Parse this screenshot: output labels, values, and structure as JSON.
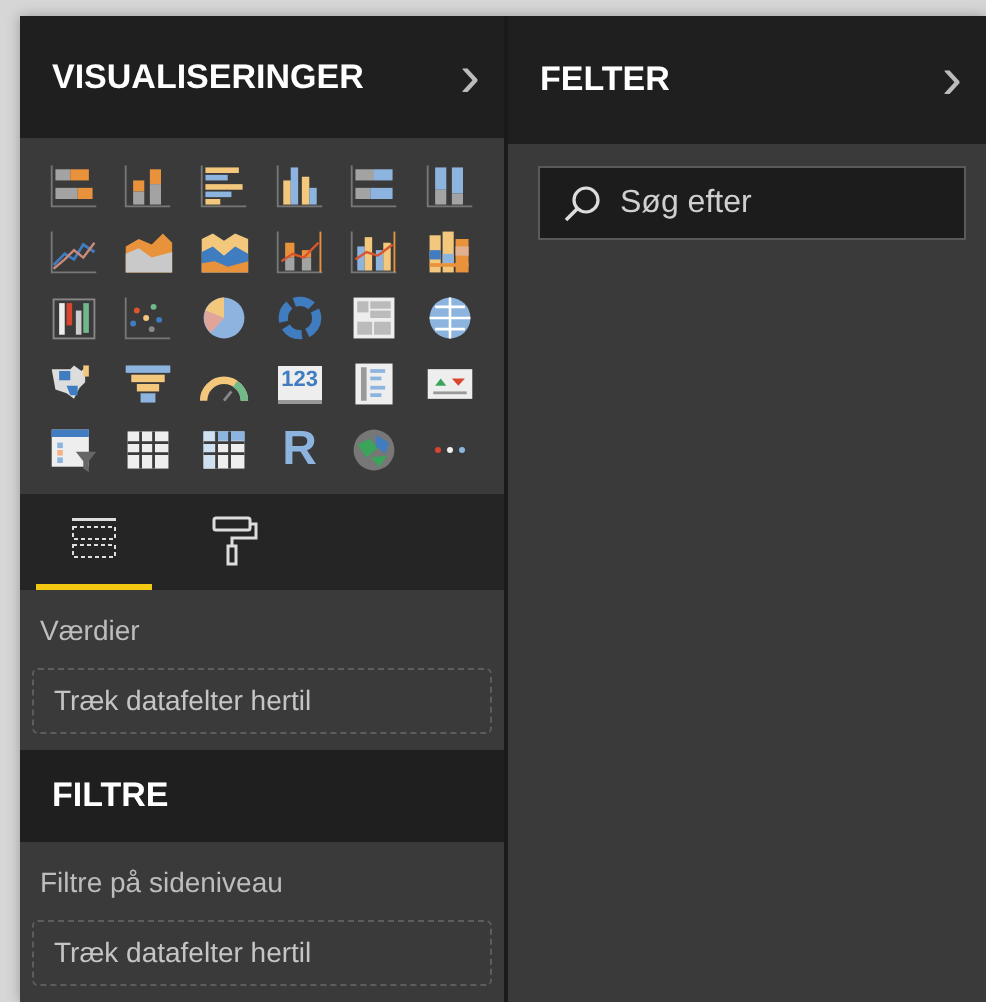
{
  "visualizations": {
    "title": "VISUALISERINGER",
    "chevron": "›",
    "icons": [
      {
        "kind": "stacked-bar"
      },
      {
        "kind": "stacked-column"
      },
      {
        "kind": "clustered-bar"
      },
      {
        "kind": "clustered-column"
      },
      {
        "kind": "bar-100"
      },
      {
        "kind": "column-100"
      },
      {
        "kind": "line"
      },
      {
        "kind": "area"
      },
      {
        "kind": "stacked-area"
      },
      {
        "kind": "line-stacked-column"
      },
      {
        "kind": "line-clustered-column"
      },
      {
        "kind": "ribbon"
      },
      {
        "kind": "waterfall"
      },
      {
        "kind": "scatter"
      },
      {
        "kind": "pie"
      },
      {
        "kind": "donut"
      },
      {
        "kind": "treemap"
      },
      {
        "kind": "map"
      },
      {
        "kind": "filled-map"
      },
      {
        "kind": "funnel"
      },
      {
        "kind": "gauge"
      },
      {
        "kind": "card",
        "label": "123"
      },
      {
        "kind": "multi-row-card"
      },
      {
        "kind": "kpi"
      },
      {
        "kind": "slicer"
      },
      {
        "kind": "table"
      },
      {
        "kind": "matrix"
      },
      {
        "kind": "letter",
        "label": "R"
      },
      {
        "kind": "globe"
      },
      {
        "kind": "more"
      }
    ],
    "tabs": [
      {
        "kind": "fields",
        "selected": true
      },
      {
        "kind": "format",
        "selected": false
      }
    ],
    "values": {
      "label": "Værdier",
      "drop_hint": "Træk datafelter hertil"
    }
  },
  "filters": {
    "title": "FILTRE",
    "label": "Filtre på sideniveau",
    "drop_hint": "Træk datafelter hertil"
  },
  "fields": {
    "title": "FELTER",
    "chevron": "›",
    "search": {
      "placeholder": "Søg efter"
    }
  }
}
